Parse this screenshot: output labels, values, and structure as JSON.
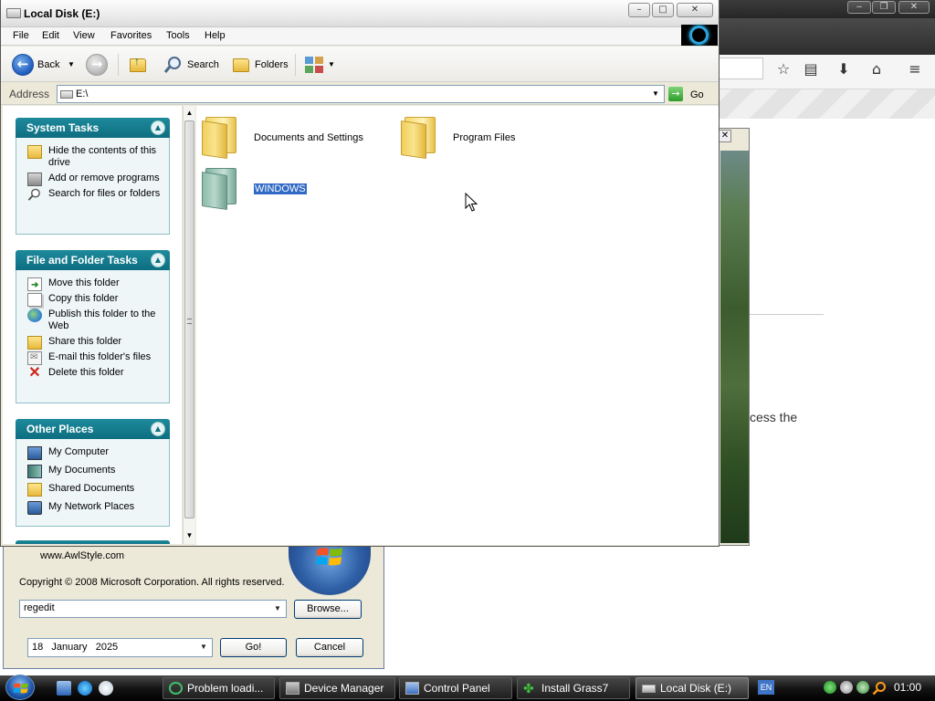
{
  "browser": {
    "page_text_fragment": "cess the",
    "dialog_close_glyph": "✕"
  },
  "explorer": {
    "title": "Local Disk (E:)",
    "menu": [
      "File",
      "Edit",
      "View",
      "Favorites",
      "Tools",
      "Help"
    ],
    "toolbar": {
      "back_label": "Back",
      "search_label": "Search",
      "folders_label": "Folders"
    },
    "address": {
      "label": "Address",
      "value": "E:\\",
      "go_label": "Go"
    },
    "task_groups": [
      {
        "title": "System Tasks",
        "tasks": [
          {
            "label": "Hide the contents of this drive",
            "icon": "hide-contents-icon"
          },
          {
            "label": "Add or remove programs",
            "icon": "add-remove-programs-icon"
          },
          {
            "label": "Search for files or folders",
            "icon": "search-icon"
          }
        ]
      },
      {
        "title": "File and Folder Tasks",
        "tasks": [
          {
            "label": "Move this folder",
            "icon": "move-folder-icon"
          },
          {
            "label": "Copy this folder",
            "icon": "copy-folder-icon"
          },
          {
            "label": "Publish this folder to the Web",
            "icon": "publish-web-icon"
          },
          {
            "label": "Share this folder",
            "icon": "share-folder-icon"
          },
          {
            "label": "E-mail this folder's files",
            "icon": "email-icon"
          },
          {
            "label": "Delete this folder",
            "icon": "delete-icon"
          }
        ]
      },
      {
        "title": "Other Places",
        "tasks": [
          {
            "label": "My Computer",
            "icon": "my-computer-icon"
          },
          {
            "label": "My Documents",
            "icon": "my-documents-icon"
          },
          {
            "label": "Shared Documents",
            "icon": "shared-documents-icon"
          },
          {
            "label": "My Network Places",
            "icon": "network-places-icon"
          }
        ]
      }
    ],
    "files": [
      {
        "name": "Documents and Settings",
        "selected": false
      },
      {
        "name": "Program Files",
        "selected": false
      },
      {
        "name": "WINDOWS",
        "selected": true
      }
    ]
  },
  "run_dialog": {
    "website": "www.AwlStyle.com",
    "copyright": "Copyright © 2008 Microsoft Corporation. All rights reserved.",
    "command_value": "regedit",
    "browse_label": "Browse...",
    "date_value": "18   January   2025",
    "go_label": "Go!",
    "cancel_label": "Cancel"
  },
  "taskbar": {
    "tasks": [
      "Problem loadi...",
      "Device Manager",
      "Control Panel",
      "Install Grass7",
      "Local Disk (E:)"
    ],
    "active_task": "Local Disk (E:)",
    "language": "EN",
    "clock": "01:00"
  },
  "colors": {
    "selection": "#316ac5",
    "task_header": "#1d8a9c",
    "taskbar": "#141414"
  }
}
